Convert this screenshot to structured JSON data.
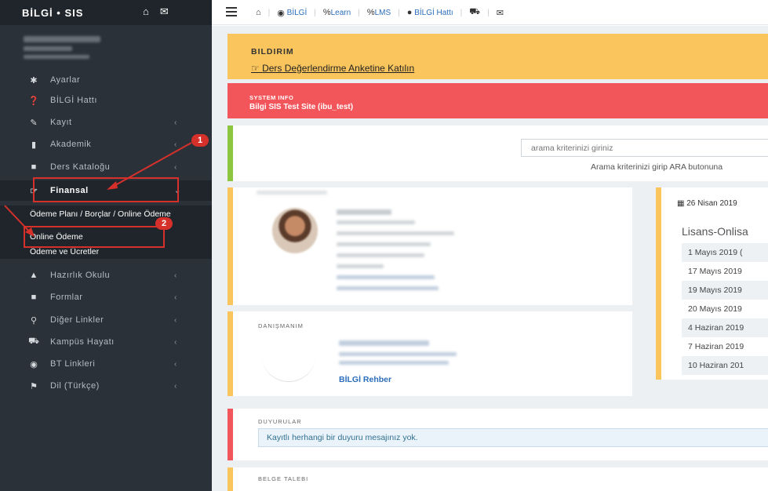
{
  "brand": {
    "name": "BİLGİ • SIS"
  },
  "sidebar": {
    "items": [
      {
        "icon": "gear-icon",
        "glyph": "✱",
        "label": "Ayarlar"
      },
      {
        "icon": "question-circle-icon",
        "glyph": "❓",
        "label": "BİLGİ Hattı"
      },
      {
        "icon": "pencil-icon",
        "glyph": "✎",
        "label": "Kayıt"
      },
      {
        "icon": "book-icon",
        "glyph": "▮",
        "label": "Akademik"
      },
      {
        "icon": "catalog-icon",
        "glyph": "■",
        "label": "Ders Kataloğu"
      },
      {
        "icon": "finance-icon",
        "glyph": "☞",
        "label": "Finansal"
      },
      {
        "icon": "graduation-icon",
        "glyph": "▲",
        "label": "Hazırlık Okulu"
      },
      {
        "icon": "form-icon",
        "glyph": "■",
        "label": "Formlar"
      },
      {
        "icon": "link-icon",
        "glyph": "⚲",
        "label": "Diğer Linkler"
      },
      {
        "icon": "campus-icon",
        "glyph": "⛟",
        "label": "Kampüs Hayatı"
      },
      {
        "icon": "globe-icon",
        "glyph": "◉",
        "label": "BT Linkleri"
      },
      {
        "icon": "flag-icon",
        "glyph": "⚑",
        "label": "Dil (Türkçe)"
      }
    ],
    "finance_submenu": [
      "Ödeme Planı / Borçlar / Online Ödeme",
      "Online Ödeme",
      "Ödeme ve Ücretler"
    ],
    "badges": [
      "1",
      "2"
    ]
  },
  "topnav": {
    "items": [
      {
        "label": "BİLGİ"
      },
      {
        "label": "Learn"
      },
      {
        "label": "LMS"
      },
      {
        "label": "BİLGİ Hattı"
      }
    ]
  },
  "notice": {
    "title": "BILDIRIM",
    "link": "Ders Değerlendirme Anketine Katılın"
  },
  "system_info": {
    "title": "SYSTEM INFO",
    "text": "Bilgi SIS Test Site (ibu_test)"
  },
  "search": {
    "placeholder": "arama kriterinizi giriniz",
    "hint": "Arama kriterinizi girip ARA butonuna"
  },
  "advisor": {
    "title": "DANIŞMANIM",
    "guide_link": "BİLGİ Rehber"
  },
  "calendar": {
    "date": "26 Nisan 2019",
    "heading": "Lisans-Onlisa",
    "rows": [
      "1 Mayıs 2019 (",
      "17 Mayıs 2019",
      "19 Mayıs 2019",
      "20 Mayıs 2019",
      "4 Haziran 2019",
      "7 Haziran 2019",
      "10 Haziran 201"
    ]
  },
  "announcements": {
    "title": "DUYURULAR",
    "message": "Kayıtlı herhangi bir duyuru mesajınız yok."
  },
  "document_request": {
    "title": "BELGE TALEBI"
  },
  "colors": {
    "sidebar_bg": "#2b3138",
    "accent_yellow": "#fbc55d",
    "accent_red": "#f2555a",
    "accent_green": "#8cc63f",
    "link_blue": "#2a6ebb",
    "annotation_red": "#d6302b"
  }
}
